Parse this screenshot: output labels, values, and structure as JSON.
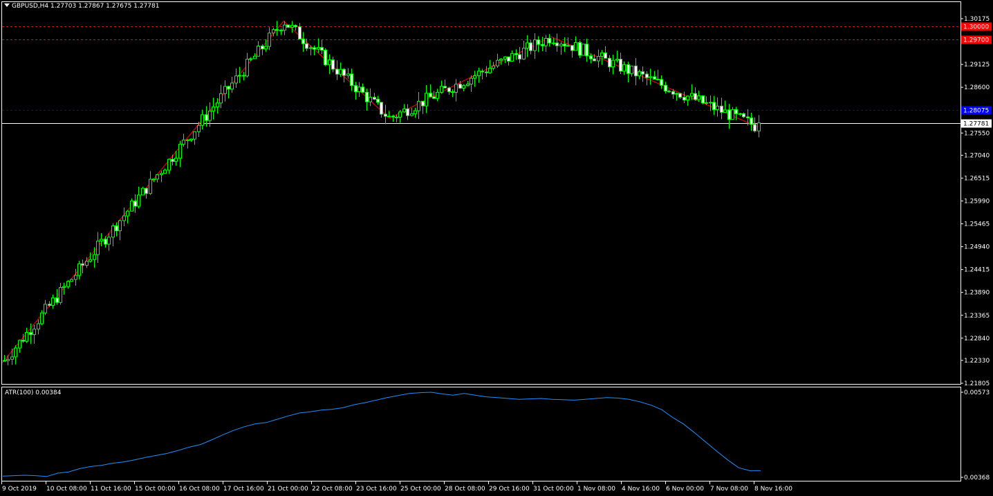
{
  "header": {
    "symbol_line": "GBPUSD,H4  1.27703 1.27867 1.27675 1.27781",
    "menu_icon": "triangle-down-icon"
  },
  "price_axis_ticks": [
    "1.30175",
    "1.29125",
    "1.28600",
    "1.28075",
    "1.27550",
    "1.27040",
    "1.26515",
    "1.25990",
    "1.25465",
    "1.24940",
    "1.24415",
    "1.23890",
    "1.23365",
    "1.22840",
    "1.22330",
    "1.21805"
  ],
  "price_tags": [
    {
      "label": "1.30000",
      "value": 1.3,
      "color": "#ff0000",
      "line": "dashed"
    },
    {
      "label": "1.29700",
      "value": 1.297,
      "color": "#ff0000",
      "line": "dashed"
    },
    {
      "label": "1.28075",
      "value": 1.28075,
      "color": "#0000ff",
      "line": "dashed"
    },
    {
      "label": "1.27781",
      "value": 1.27781,
      "color": "#ffffff",
      "line": "solid"
    }
  ],
  "atr": {
    "label": "ATR(100) 0.00384",
    "ticks": [
      "0.00573",
      "0.00368"
    ],
    "color": "#1e90ff"
  },
  "time_axis_labels": [
    "9 Oct 2019",
    "10 Oct 08:00",
    "11 Oct 16:00",
    "15 Oct 00:00",
    "16 Oct 08:00",
    "17 Oct 16:00",
    "21 Oct 00:00",
    "22 Oct 08:00",
    "23 Oct 16:00",
    "25 Oct 00:00",
    "28 Oct 08:00",
    "29 Oct 16:00",
    "31 Oct 00:00",
    "1 Nov 08:00",
    "4 Nov 16:00",
    "6 Nov 00:00",
    "7 Nov 08:00",
    "8 Nov 16:00"
  ],
  "colors": {
    "background": "#000000",
    "candle": "#00ff00",
    "bull_body": "#000000",
    "bear_body": "#ffffff",
    "zigzag": "#ff0000",
    "grid_text": "#ffffff"
  },
  "chart_data": {
    "type": "candlestick",
    "symbol": "GBPUSD",
    "timeframe": "H4",
    "ohlc": {
      "open": 1.27703,
      "high": 1.27867,
      "low": 1.27675,
      "close": 1.27781
    },
    "ylim": [
      1.21805,
      1.30175
    ],
    "zigzag": [
      {
        "x": "9 Oct 2019",
        "y": 1.2227
      },
      {
        "x": "21 Oct 04:00",
        "y": 1.3012
      },
      {
        "x": "23 Oct 16:00",
        "y": 1.2789
      },
      {
        "x": "31 Oct 00:00",
        "y": 1.2976
      },
      {
        "x": "8 Nov 16:00",
        "y": 1.2768
      }
    ],
    "atr_series": [
      0.00371,
      0.00372,
      0.00373,
      0.00372,
      0.0037,
      0.00378,
      0.00381,
      0.00389,
      0.00394,
      0.00397,
      0.00402,
      0.00405,
      0.0041,
      0.00416,
      0.00421,
      0.00426,
      0.00433,
      0.00441,
      0.00447,
      0.00458,
      0.0047,
      0.00481,
      0.0049,
      0.00497,
      0.005,
      0.00508,
      0.00516,
      0.00523,
      0.00526,
      0.0053,
      0.00532,
      0.00536,
      0.00543,
      0.00548,
      0.00554,
      0.0056,
      0.00565,
      0.0057,
      0.00572,
      0.00573,
      0.00569,
      0.00566,
      0.0057,
      0.00566,
      0.00562,
      0.0056,
      0.00558,
      0.00556,
      0.00557,
      0.00558,
      0.00556,
      0.00555,
      0.00554,
      0.00556,
      0.00558,
      0.0056,
      0.00559,
      0.00556,
      0.0055,
      0.00542,
      0.00531,
      0.00512,
      0.00496,
      0.00475,
      0.00453,
      0.00431,
      0.0041,
      0.00391,
      0.00384,
      0.00384
    ]
  }
}
